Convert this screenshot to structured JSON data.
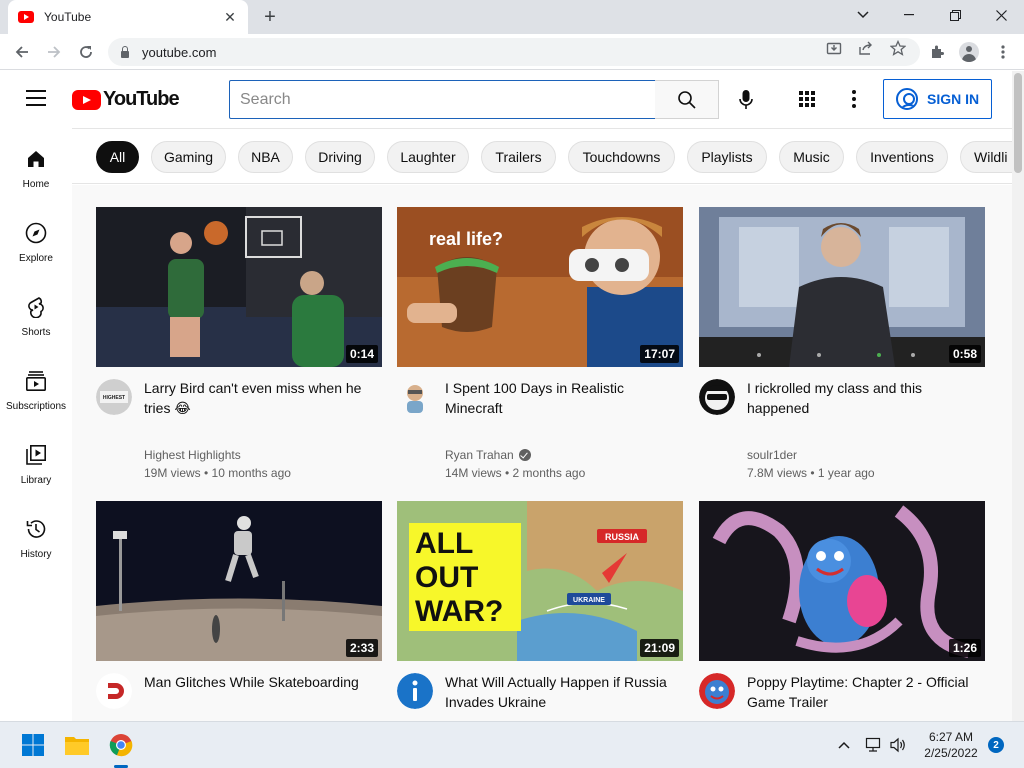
{
  "browser": {
    "tab_title": "YouTube",
    "tab_close": "✕",
    "new_tab": "+",
    "url": "youtube.com",
    "window_controls": [
      "⌄",
      "—",
      "❐",
      "✕"
    ]
  },
  "youtube": {
    "logo_text": "YouTube",
    "search_placeholder": "Search",
    "signin_label": "SIGN IN",
    "chips": [
      "All",
      "Gaming",
      "NBA",
      "Driving",
      "Laughter",
      "Trailers",
      "Touchdowns",
      "Playlists",
      "Music",
      "Inventions",
      "Wildli"
    ],
    "sidebar": [
      {
        "label": "Home",
        "icon": "home-icon"
      },
      {
        "label": "Explore",
        "icon": "compass-icon"
      },
      {
        "label": "Shorts",
        "icon": "shorts-icon"
      },
      {
        "label": "Subscriptions",
        "icon": "subscriptions-icon"
      },
      {
        "label": "Library",
        "icon": "library-icon"
      },
      {
        "label": "History",
        "icon": "history-icon"
      }
    ],
    "videos": [
      {
        "title": "Larry Bird can't even miss when he tries 😂",
        "channel": "Highest Highlights",
        "meta": "19M views • 10 months ago",
        "duration": "0:14",
        "verified": false
      },
      {
        "title": "I Spent 100 Days in Realistic Minecraft",
        "channel": "Ryan Trahan",
        "meta": "14M views • 2 months ago",
        "duration": "17:07",
        "verified": true
      },
      {
        "title": "I rickrolled my class and this happened",
        "channel": "soulr1der",
        "meta": "7.8M views • 1 year ago",
        "duration": "0:58",
        "verified": false
      },
      {
        "title": "Man Glitches While Skateboarding",
        "channel": "",
        "meta": "",
        "duration": "2:33",
        "verified": false
      },
      {
        "title": "What Will Actually Happen if Russia Invades Ukraine",
        "channel": "",
        "meta": "",
        "duration": "21:09",
        "verified": false
      },
      {
        "title": "Poppy Playtime: Chapter 2 - Official Game Trailer",
        "channel": "",
        "meta": "",
        "duration": "1:26",
        "verified": false
      }
    ],
    "thumb_text": {
      "real_life": "real life?",
      "all_out_war": "ALL OUT WAR?",
      "russia": "RUSSIA",
      "ukraine": "UKRAINE",
      "highest": "HIGHEST HIGHLIGHTS"
    }
  },
  "taskbar": {
    "time": "6:27 AM",
    "date": "2/25/2022",
    "notifications": "2"
  },
  "colors": {
    "brand_red": "#ff0000",
    "signin_blue": "#065fd4",
    "taskbar_bg": "#e8edf3"
  }
}
